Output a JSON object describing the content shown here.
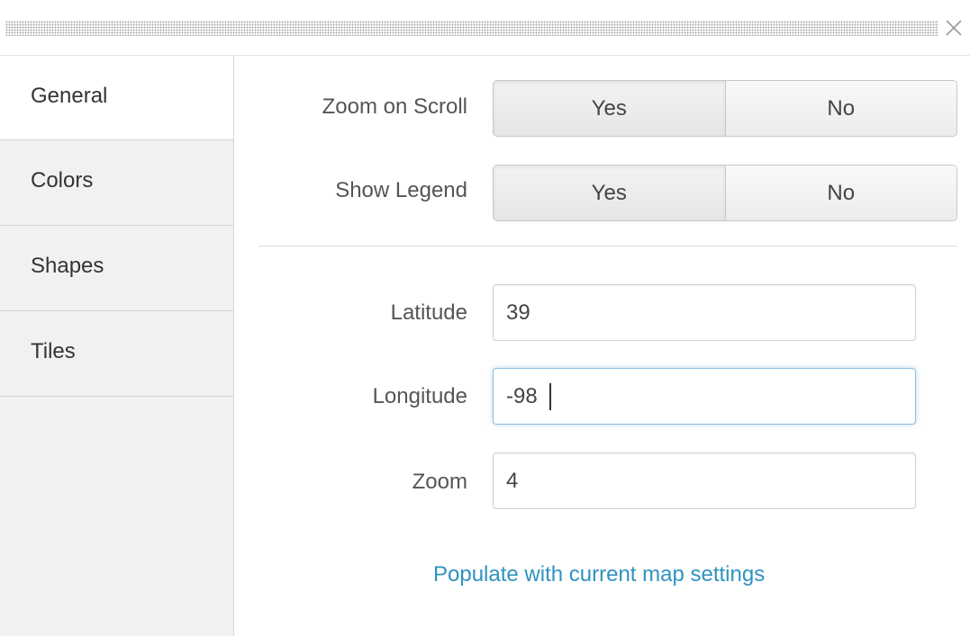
{
  "dialog": {
    "close_icon": "close-icon"
  },
  "sidebar": {
    "items": [
      {
        "label": "General",
        "active": true
      },
      {
        "label": "Colors",
        "active": false
      },
      {
        "label": "Shapes",
        "active": false
      },
      {
        "label": "Tiles",
        "active": false
      }
    ]
  },
  "general": {
    "zoom_on_scroll": {
      "label": "Zoom on Scroll",
      "options": [
        "Yes",
        "No"
      ],
      "selected": "Yes"
    },
    "show_legend": {
      "label": "Show Legend",
      "options": [
        "Yes",
        "No"
      ],
      "selected": "Yes"
    },
    "latitude": {
      "label": "Latitude",
      "value": "39"
    },
    "longitude": {
      "label": "Longitude",
      "value": "-98",
      "focused": true
    },
    "zoom": {
      "label": "Zoom",
      "value": "4"
    },
    "populate_link": "Populate with current map settings"
  },
  "colors": {
    "link": "#2f93c0",
    "focus_border": "#8ac1e6"
  }
}
